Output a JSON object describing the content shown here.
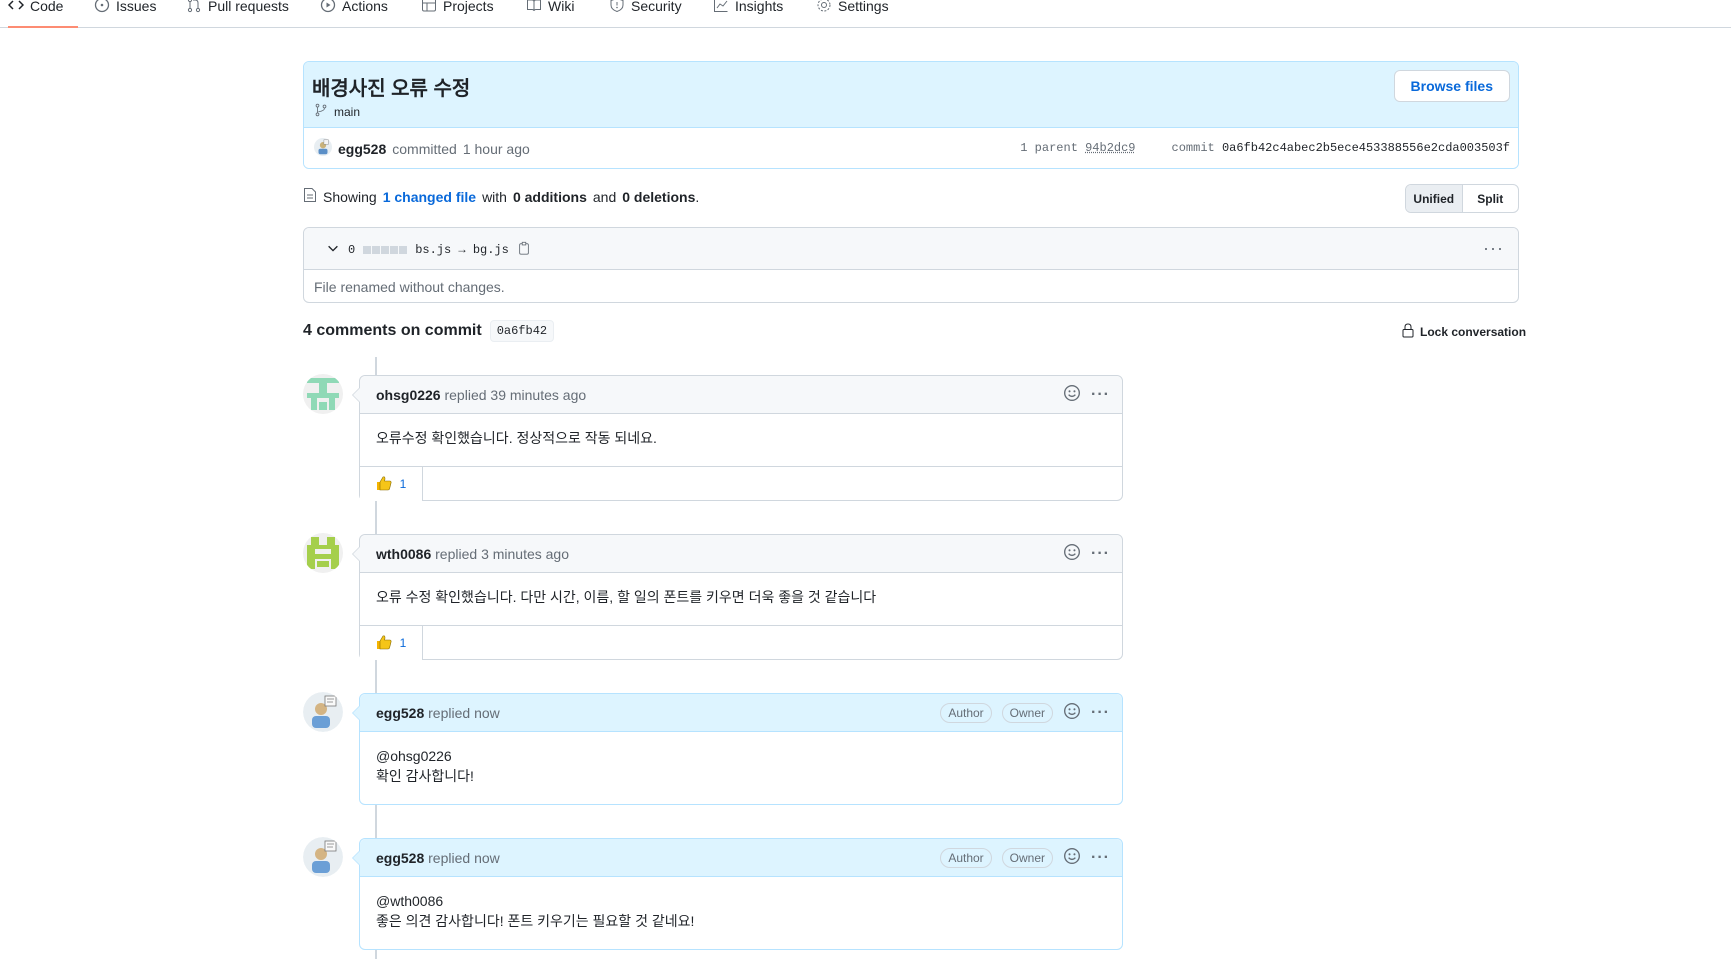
{
  "nav": {
    "tabs": [
      {
        "label": "Code",
        "icon": "code-icon",
        "selected": true
      },
      {
        "label": "Issues",
        "icon": "issue-icon"
      },
      {
        "label": "Pull requests",
        "icon": "pull-request-icon"
      },
      {
        "label": "Actions",
        "icon": "play-icon"
      },
      {
        "label": "Projects",
        "icon": "table-icon"
      },
      {
        "label": "Wiki",
        "icon": "book-icon"
      },
      {
        "label": "Security",
        "icon": "shield-icon"
      },
      {
        "label": "Insights",
        "icon": "graph-icon"
      },
      {
        "label": "Settings",
        "icon": "gear-icon"
      }
    ]
  },
  "commit": {
    "title": "배경사진 오류 수정",
    "branch": "main",
    "browse_label": "Browse files",
    "author": "egg528",
    "committed_text": "committed",
    "time": "1 hour ago",
    "parent_label": "1 parent",
    "parent_sha": "94b2dc9",
    "commit_label": "commit",
    "commit_sha": "0a6fb42c4abec2b5ece453388556e2cda003503f"
  },
  "summary": {
    "showing": "Showing",
    "changed": "1 changed file",
    "with": "with",
    "additions": "0 additions",
    "and": "and",
    "deletions": "0 deletions",
    "period": ".",
    "unified_label": "Unified",
    "split_label": "Split"
  },
  "file": {
    "count": "0",
    "name": "bs.js → bg.js",
    "body": "File renamed without changes."
  },
  "comments_header": {
    "title": "4 comments on commit",
    "sha": "0a6fb42",
    "lock_label": "Lock conversation"
  },
  "comments": [
    {
      "author": "ohsg0226",
      "action": "replied",
      "time": "39 minutes ago",
      "body_lines": [
        "오류수정 확인했습니다. 정상적으로 작동 되네요."
      ],
      "reaction_count": "1"
    },
    {
      "author": "wth0086",
      "action": "replied",
      "time": "3 minutes ago",
      "body_lines": [
        "오류 수정 확인했습니다. 다만 시간, 이름, 할 일의 폰트를 키우면 더욱 좋을 것 같습니다"
      ],
      "reaction_count": "1"
    },
    {
      "author": "egg528",
      "action": "replied",
      "time": "now",
      "badges": [
        "Author",
        "Owner"
      ],
      "body_lines": [
        "@ohsg0226",
        "확인 감사합니다!"
      ]
    },
    {
      "author": "egg528",
      "action": "replied",
      "time": "now",
      "badges": [
        "Author",
        "Owner"
      ],
      "body_lines": [
        "@wth0086",
        "좋은 의견 감사합니다! 폰트 키우기는 필요할 것 같네요!"
      ]
    }
  ],
  "colors": {
    "accent": "#0969da",
    "header_blue": "#ddf4ff",
    "border": "#d0d7de",
    "tab_underline": "#fd8c73"
  }
}
